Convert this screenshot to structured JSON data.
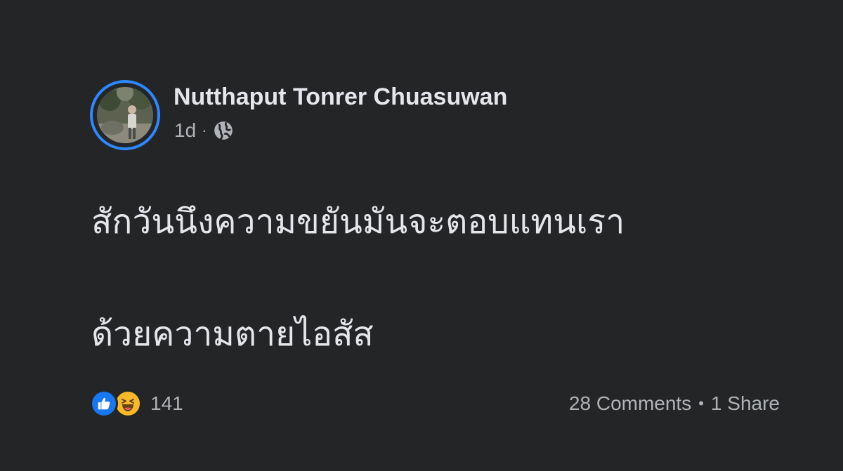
{
  "post": {
    "author": "Nutthaput Tonrer Chuasuwan",
    "time": "1d",
    "separator": "·",
    "audience_icon": "globe-icon",
    "text_lines": [
      "สักวันนึงความขยันมันจะตอบแทนเรา",
      "ด้วยความตายไอสัส"
    ],
    "reactions": {
      "icons": [
        "like-icon",
        "haha-icon"
      ],
      "count": "141"
    },
    "comments": "28 Comments",
    "shares": "1 Share",
    "stats_separator": "•"
  },
  "colors": {
    "background": "#242526",
    "primary_text": "#e4e6eb",
    "secondary_text": "#b0b3b8",
    "avatar_ring": "#2d88ff",
    "like": "#1877f2",
    "haha": "#f7b928"
  }
}
